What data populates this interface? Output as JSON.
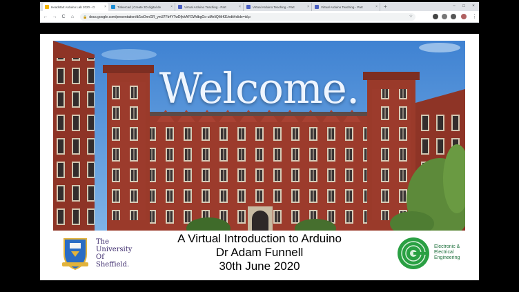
{
  "browser": {
    "tabs": [
      {
        "title": "Headstart Arduino Lab 2020 - G",
        "favicon_color": "#f4b400",
        "active": true
      },
      {
        "title": "Tinkercad | Create 3D digital de",
        "favicon_color": "#1c8fd6",
        "active": false
      },
      {
        "title": "Virtual Arduino Teaching - Part",
        "favicon_color": "#4a5fc1",
        "active": false
      },
      {
        "title": "Virtual Arduino Teaching - Part",
        "favicon_color": "#4a5fc1",
        "active": false
      },
      {
        "title": "Virtual Arduino Teaching - Part",
        "favicon_color": "#4a5fc1",
        "active": false
      }
    ],
    "tab_close_glyph": "×",
    "new_tab_glyph": "+",
    "window_controls": [
      "–",
      "□",
      "×"
    ],
    "nav": {
      "back": "←",
      "forward": "→",
      "reload": "C",
      "home": "⌂"
    },
    "url": "docs.google.com/presentation/d/1wDnnGR_ym37Fb4YTwDfjvkAFGWdbgGo-uMeIiQMrKE/edit#slide=id.p",
    "lock_glyph": "🔒",
    "bookmark_glyph": "☆",
    "menu_glyph": "⋮",
    "extension_colors": [
      "#444444",
      "#777777",
      "#555555",
      "#b06060",
      "#666666"
    ]
  },
  "slide": {
    "heading": "Welcome.",
    "caption_lines": [
      "A Virtual Introduction to Arduino",
      "Dr Adam Funnell",
      "30th June 2020"
    ],
    "university_name_lines": [
      "The",
      "University",
      "Of",
      "Sheffield."
    ],
    "department_lines": [
      "Electronic &",
      "Electrical",
      "Engineering"
    ],
    "colors": {
      "brick": "#9c3b2c",
      "sky": "#4d8fd6",
      "uni_purple": "#3e2c6e",
      "eee_green": "#2aa043"
    }
  }
}
